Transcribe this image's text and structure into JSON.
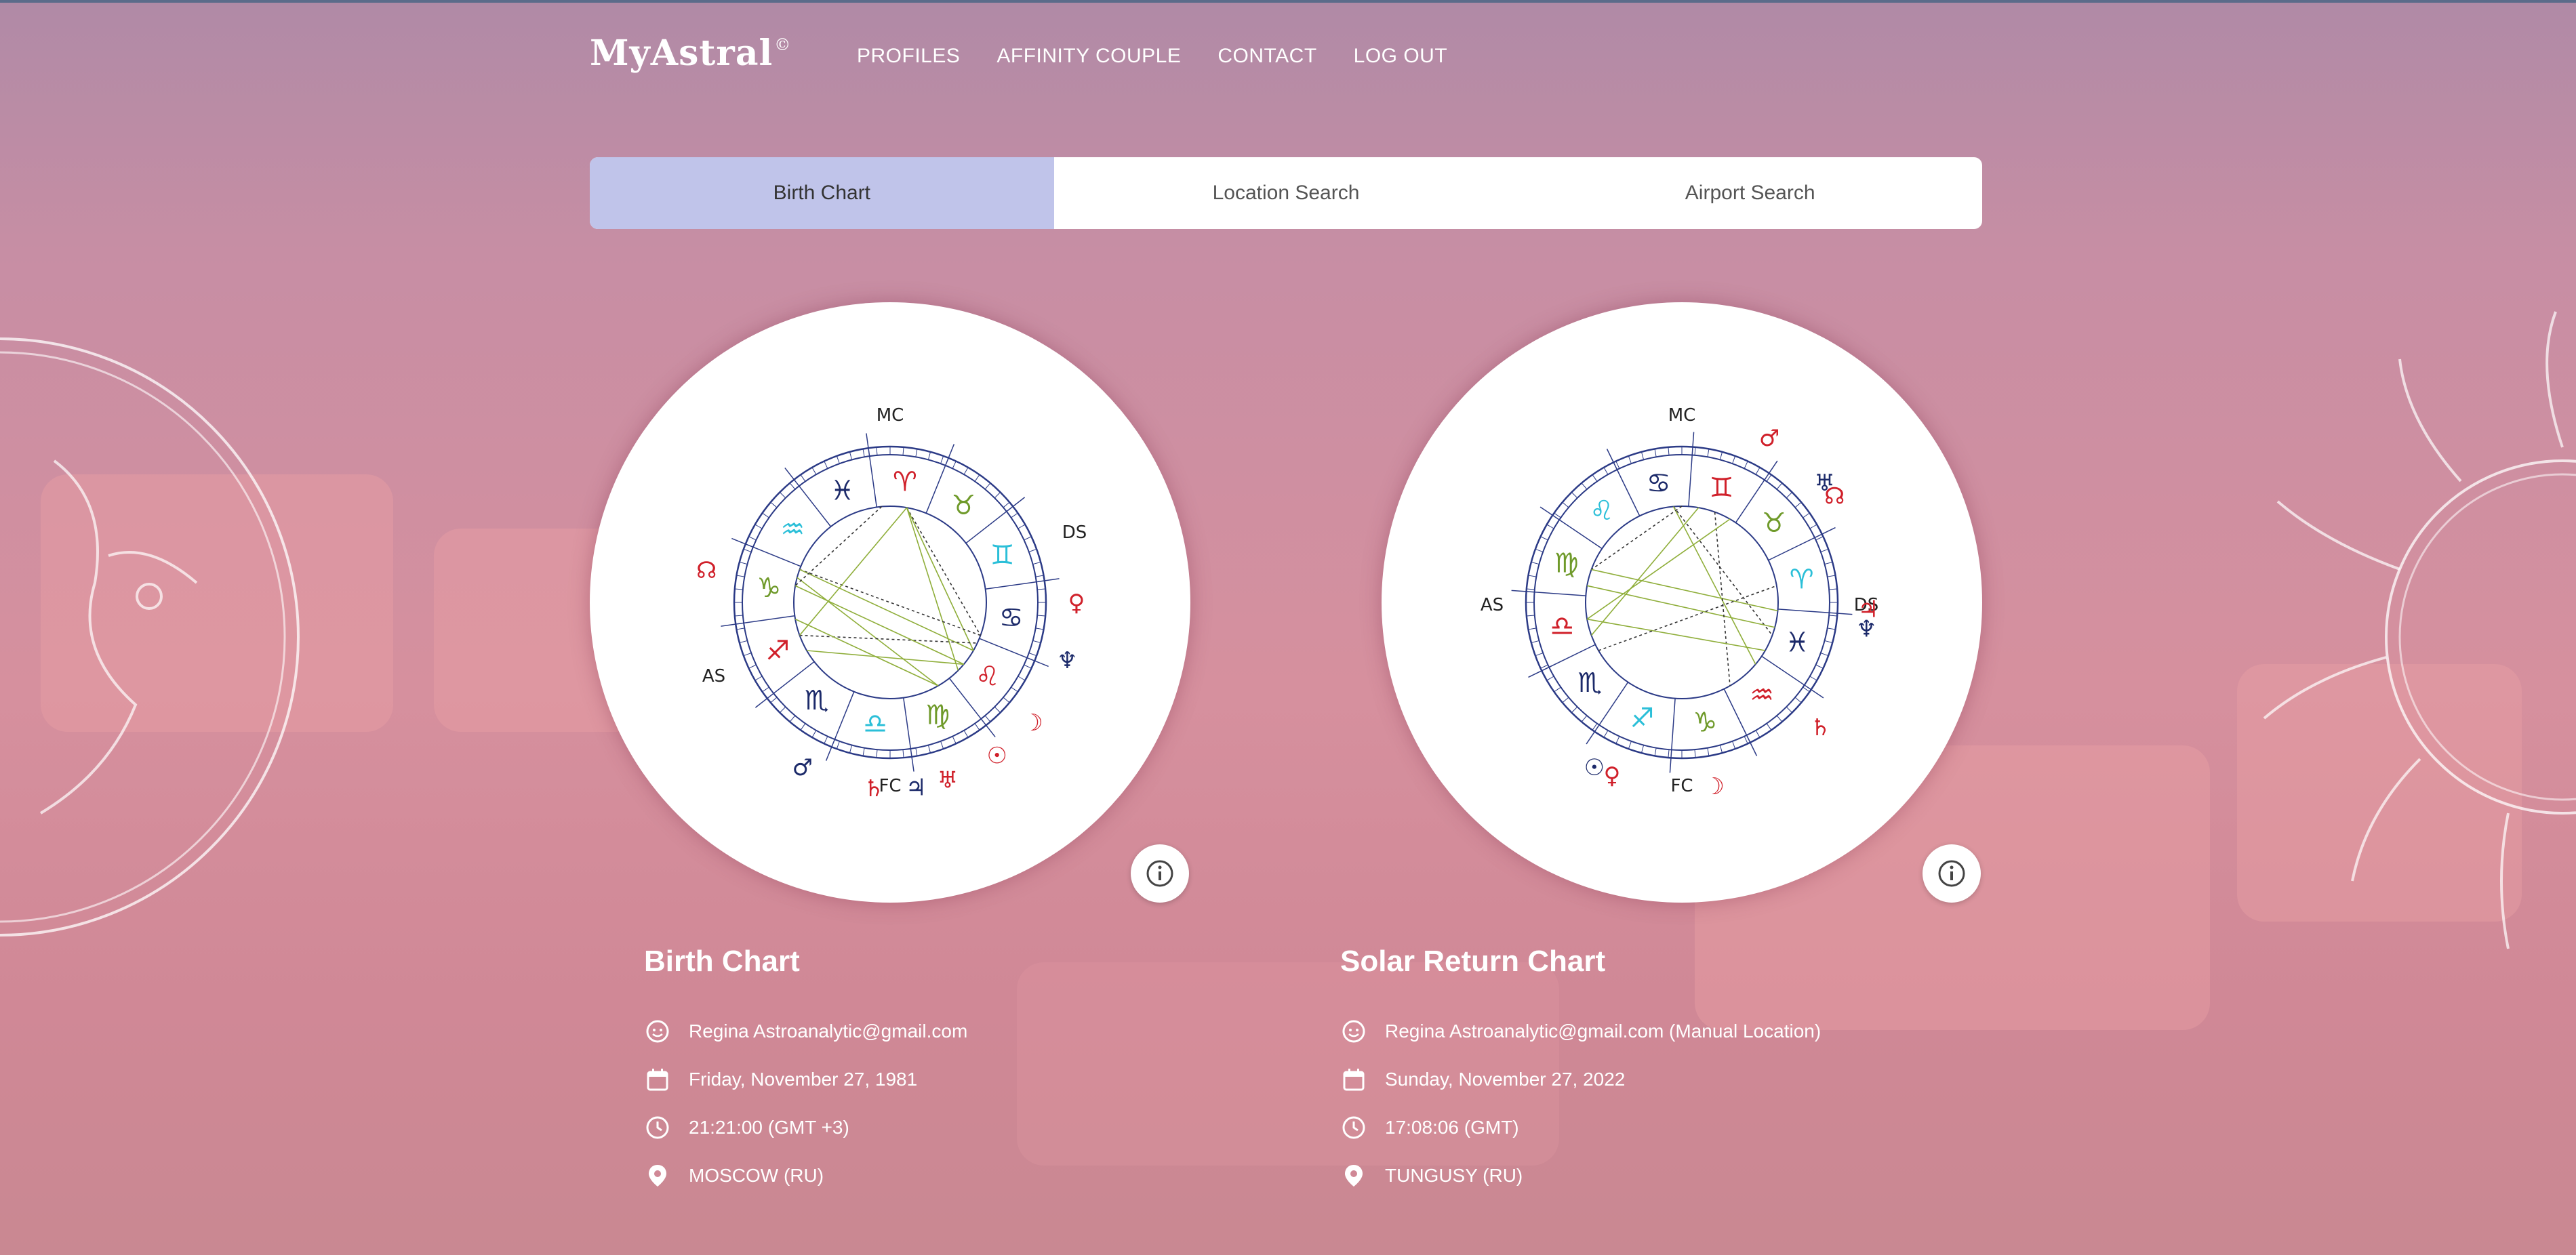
{
  "brand": {
    "name": "MyAstral",
    "mark": "©"
  },
  "nav": [
    {
      "label": "PROFILES"
    },
    {
      "label": "AFFINITY COUPLE"
    },
    {
      "label": "CONTACT"
    },
    {
      "label": "LOG OUT"
    }
  ],
  "tabs": [
    {
      "label": "Birth Chart",
      "active": true
    },
    {
      "label": "Location Search",
      "active": false
    },
    {
      "label": "Airport Search",
      "active": false
    }
  ],
  "charts": [
    {
      "title": "Birth Chart",
      "person": "Regina Astroanalytic@gmail.com",
      "date": "Friday, November 27, 1981",
      "time": "21:21:00 (GMT +3)",
      "location": "MOSCOW (RU)",
      "angles": {
        "mc": "MC",
        "ds": "DS",
        "as": "AS",
        "fc": "FC"
      },
      "zodiac_glyphs": [
        "♈",
        "♉",
        "♊",
        "♋",
        "♌",
        "♍",
        "♎",
        "♏",
        "♐",
        "♑",
        "♒",
        "♓"
      ],
      "planet_glyphs": [
        "♀",
        "♆",
        "☽",
        "☉",
        "♂",
        "♄",
        "♅",
        "♃",
        "☊"
      ]
    },
    {
      "title": "Solar Return Chart",
      "person": "Regina Astroanalytic@gmail.com (Manual Location)",
      "date": "Sunday, November 27, 2022",
      "time": "17:08:06 (GMT)",
      "location": "TUNGUSY (RU)",
      "angles": {
        "mc": "MC",
        "ds": "DS",
        "as": "AS",
        "fc": "FC"
      },
      "zodiac_glyphs": [
        "♊",
        "♉",
        "♈",
        "♓",
        "♒",
        "♑",
        "♐",
        "♏",
        "♎",
        "♍",
        "♌",
        "♋"
      ],
      "planet_glyphs": [
        "♂",
        "♅",
        "☊",
        "♃",
        "♆",
        "♄",
        "☽",
        "☉",
        "♀"
      ]
    }
  ],
  "colors": {
    "accent_tab": "#c0c4ea",
    "fire": "#d0202a",
    "earth": "#6f9a2a",
    "air": "#2bbfd8",
    "water": "#1c2a6a",
    "ring": "#2b3a86"
  }
}
